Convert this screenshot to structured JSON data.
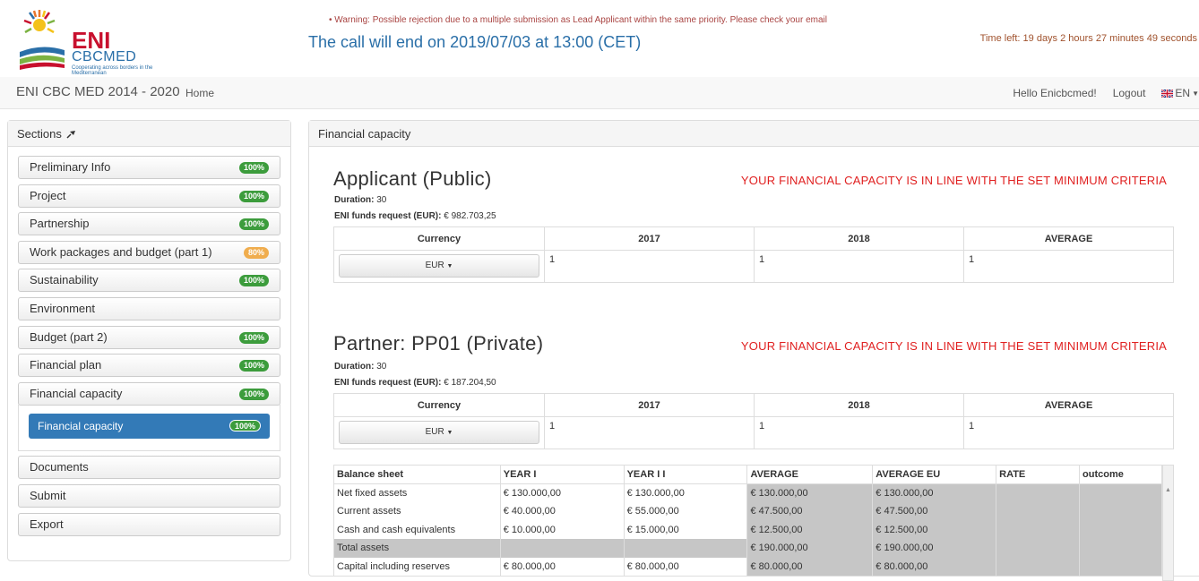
{
  "header": {
    "logo_title": "ENI",
    "logo_subtitle": "CBCMED",
    "logo_tagline": "Cooperating across borders in the Mediterranean",
    "warning": "• Warning: Possible rejection due to a multiple submission as Lead Applicant within the same priority. Please check your email",
    "call_end": "The call will end on 2019/07/03 at 13:00 (CET)",
    "time_left": "Time left: 19 days 2 hours 27 minutes 49 seconds"
  },
  "navbar": {
    "brand": "ENI CBC MED 2014 - 2020",
    "home": "Home",
    "hello": "Hello Enicbcmed!",
    "logout": "Logout",
    "lang": "EN"
  },
  "sidebar": {
    "title": "Sections",
    "items": [
      {
        "label": "Preliminary Info",
        "badge": "100%",
        "color": "#3c9c3c"
      },
      {
        "label": "Project",
        "badge": "100%",
        "color": "#3c9c3c"
      },
      {
        "label": "Partnership",
        "badge": "100%",
        "color": "#3c9c3c"
      },
      {
        "label": "Work packages and budget (part 1)",
        "badge": "80%",
        "color": "#f0ad4e"
      },
      {
        "label": "Sustainability",
        "badge": "100%",
        "color": "#3c9c3c"
      },
      {
        "label": "Environment",
        "badge": ""
      },
      {
        "label": "Budget (part 2)",
        "badge": "100%",
        "color": "#3c9c3c"
      },
      {
        "label": "Financial plan",
        "badge": "100%",
        "color": "#3c9c3c"
      },
      {
        "label": "Financial capacity",
        "badge": "100%",
        "color": "#3c9c3c"
      }
    ],
    "sub_item": {
      "label": "Financial capacity",
      "badge": "100%"
    },
    "bottom_items": [
      {
        "label": "Documents"
      },
      {
        "label": "Submit"
      },
      {
        "label": "Export"
      }
    ]
  },
  "main": {
    "title": "Financial capacity",
    "applicant": {
      "title": "Applicant (Public)",
      "criteria": "YOUR FINANCIAL CAPACITY IS IN LINE WITH THE SET MINIMUM CRITERIA",
      "duration_label": "Duration:",
      "duration": "30",
      "funds_label": "ENI funds request (EUR):",
      "funds": "€ 982.703,25"
    },
    "partner": {
      "title": "Partner:  PP01 (Private)",
      "criteria": "YOUR FINANCIAL CAPACITY IS IN LINE WITH THE SET MINIMUM CRITERIA",
      "duration_label": "Duration:",
      "duration": "30",
      "funds_label": "ENI funds request (EUR):",
      "funds": "€ 187.204,50"
    },
    "cap_table": {
      "headers": [
        "Currency",
        "2017",
        "2018",
        "AVERAGE"
      ],
      "currency_btn": "EUR",
      "values": [
        "1",
        "1",
        "1"
      ]
    },
    "balance_sheet": {
      "headers": [
        "Balance sheet",
        "YEAR I",
        "YEAR I I",
        "AVERAGE",
        "AVERAGE EU",
        "RATE",
        "outcome"
      ],
      "rows": [
        [
          "Net fixed assets",
          "€ 130.000,00",
          "€ 130.000,00",
          "€ 130.000,00",
          "€ 130.000,00",
          "",
          ""
        ],
        [
          "Current assets",
          "€ 40.000,00",
          "€ 55.000,00",
          "€ 47.500,00",
          "€ 47.500,00",
          "",
          ""
        ],
        [
          "Cash and cash equivalents",
          "€ 10.000,00",
          "€ 15.000,00",
          "€ 12.500,00",
          "€ 12.500,00",
          "",
          ""
        ],
        [
          "Total assets",
          "",
          "",
          "€ 190.000,00",
          "€ 190.000,00",
          "",
          ""
        ],
        [
          "Capital including reserves",
          "€ 80.000,00",
          "€ 80.000,00",
          "€ 80.000,00",
          "€ 80.000,00",
          "",
          ""
        ]
      ]
    }
  }
}
